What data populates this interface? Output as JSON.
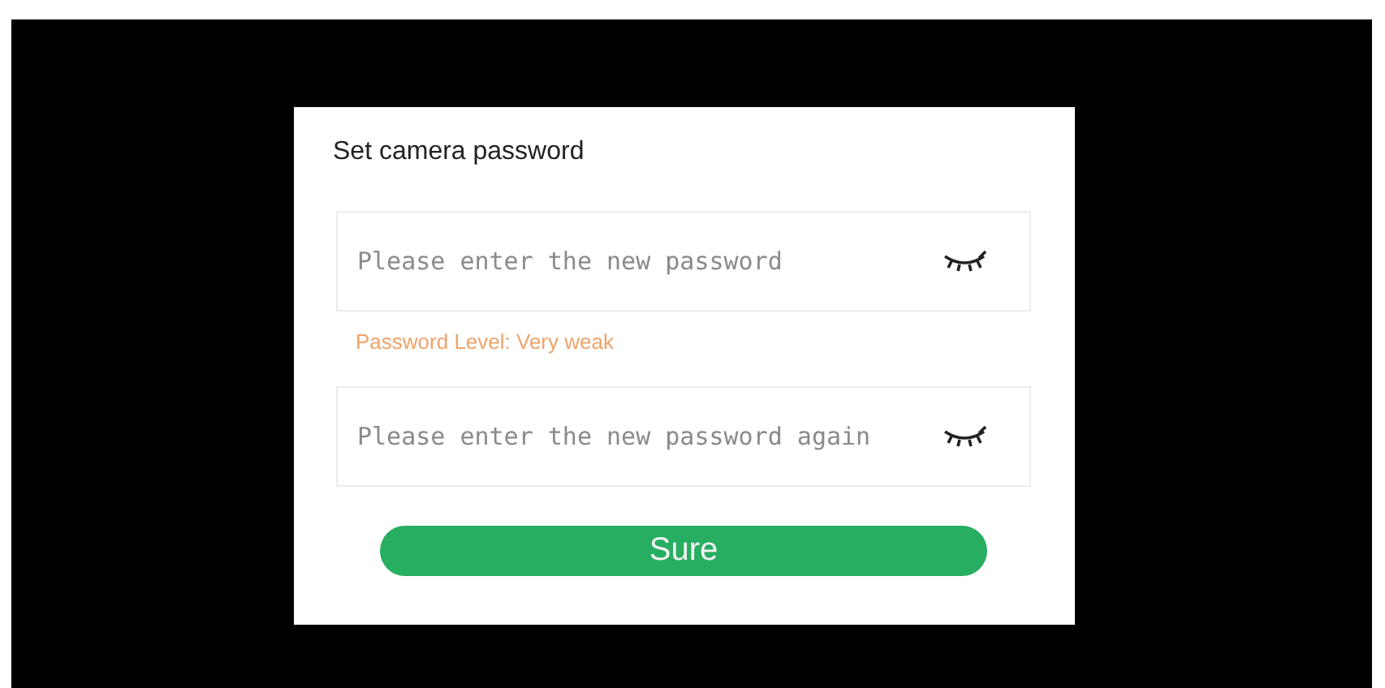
{
  "dialog": {
    "title": "Set camera password",
    "fields": [
      {
        "placeholder": "Please enter the new password",
        "password_visible": false
      },
      {
        "placeholder": "Please enter the new password again",
        "password_visible": false
      }
    ],
    "strength_text": "Password Level: Very weak",
    "button": "Sure"
  }
}
